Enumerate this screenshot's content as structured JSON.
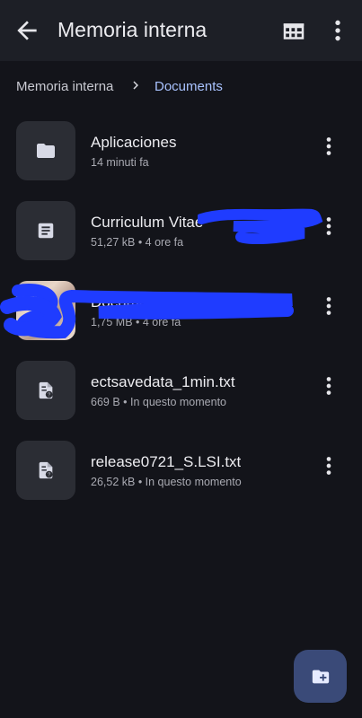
{
  "header": {
    "title": "Memoria interna",
    "back_icon": "arrow-back-icon",
    "grid_icon": "grid-view-icon",
    "more_icon": "more-vert-icon"
  },
  "breadcrumb": {
    "root": "Memoria interna",
    "current": "Documents",
    "current_color": "#a9c3ff"
  },
  "files": [
    {
      "name": "Aplicaciones",
      "meta": "14 minuti fa",
      "icon": "folder-icon"
    },
    {
      "name": "Curriculum Vitae",
      "meta": "51,27 kB • 4 ore fa",
      "icon": "document-icon"
    },
    {
      "name": "Document.pdf",
      "meta": "1,75 MB • 4 ore fa",
      "icon": "image-thumbnail"
    },
    {
      "name": "ectsavedata_1min.txt",
      "meta": "669 B • In questo momento",
      "icon": "unknown-file-icon"
    },
    {
      "name": "release0721_S.LSI.txt",
      "meta": "26,52 kB • In questo momento",
      "icon": "unknown-file-icon"
    }
  ],
  "fab": {
    "icon": "new-folder-icon",
    "color": "#3a4a78"
  },
  "colors": {
    "background": "#13141a",
    "appbar": "#1d1f26",
    "thumb": "#2b2d34",
    "redaction": "#1f3cff"
  }
}
